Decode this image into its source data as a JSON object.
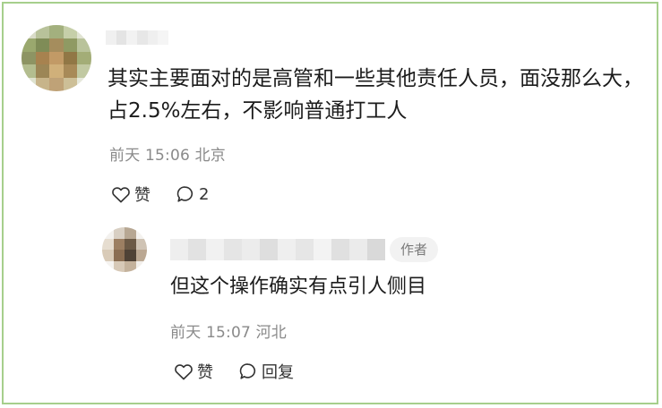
{
  "main_comment": {
    "text": "其实主要面对的是高管和一些其他责任人员，面没那么大，占2.5%左右，不影响普通打工人",
    "time": "前天 15:06",
    "location": "北京",
    "like_label": "赞",
    "comment_count": "2"
  },
  "reply": {
    "author_badge": "作者",
    "text": "但这个操作确实有点引人侧目",
    "time": "前天 15:07",
    "location": "河北",
    "like_label": "赞",
    "reply_label": "回复"
  },
  "colors": {
    "frame_border": "#a6cf8c",
    "meta_text": "#8a8a8a",
    "body_text": "#1c1c1c"
  },
  "icons": {
    "like": "heart-outline-icon",
    "comment": "speech-bubble-icon"
  }
}
